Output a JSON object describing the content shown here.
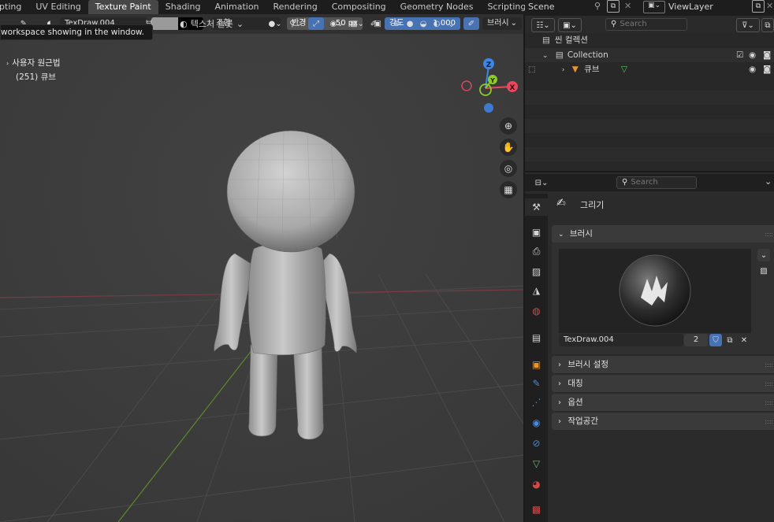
{
  "tabs": [
    "lpting",
    "UV Editing",
    "Texture Paint",
    "Shading",
    "Animation",
    "Rendering",
    "Compositing",
    "Geometry Nodes",
    "Scripting"
  ],
  "active_tab": "Texture Paint",
  "tab_add": "+",
  "scene": {
    "label": "Scene",
    "view_layer": "ViewLayer"
  },
  "viewport": {
    "tooltip": "workspace showing in the window.",
    "view_menu": "뷰",
    "texture_slot": "텍스처 슬롯",
    "brush_name": "TexDraw.004",
    "blend_mode": "조합",
    "radius_label": "반경",
    "radius_value": "50 px",
    "strength_label": "강도",
    "strength_value": "1.000",
    "brush_menu": "브러시",
    "perspective": "사용자 원근법",
    "object_info": "(251) 큐브",
    "gizmo_z": "Z",
    "gizmo_y": "Y",
    "gizmo_x": "X"
  },
  "outliner": {
    "search_placeholder": "Search",
    "scene_collection": "씬 컬렉션",
    "collection": "Collection",
    "object": "큐브"
  },
  "properties": {
    "search_placeholder": "Search",
    "tool_name": "그리기",
    "brushes_panel": "브러시",
    "brush_name": "TexDraw.004",
    "brush_users": "2",
    "panels": [
      "브러시 설정",
      "대칭",
      "옵션",
      "작업공간"
    ]
  },
  "colors": {
    "accent_blue": "#4772b3",
    "active_tab_bg": "#474747",
    "viewport_bg": "#3d3d3d",
    "axis_x": "#e8485e",
    "axis_y": "#8ccb2a",
    "axis_z": "#3c86e8",
    "object_orange": "#e8952e",
    "mesh_green": "#5fc468"
  }
}
